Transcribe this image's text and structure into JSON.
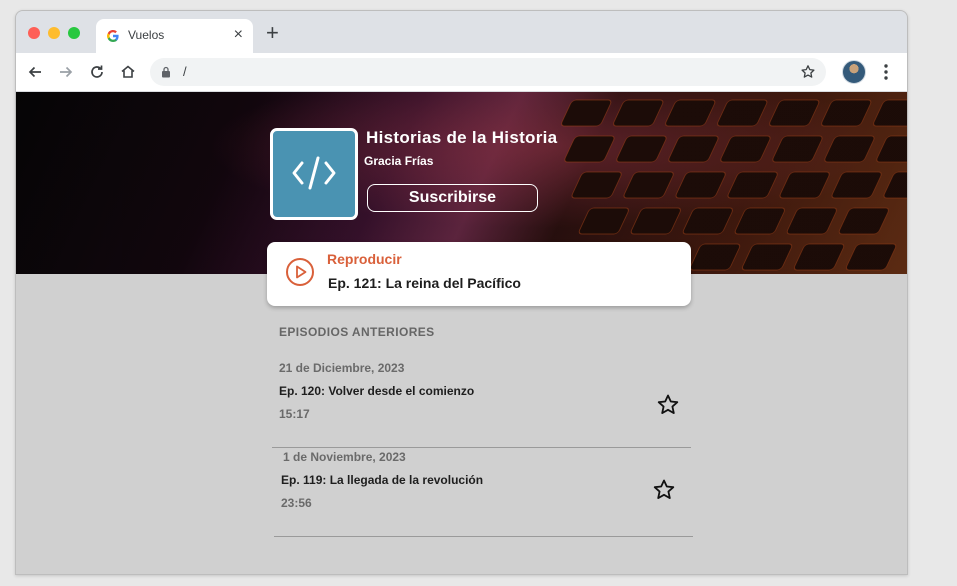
{
  "browser": {
    "tab_title": "Vuelos",
    "tab_close": "×",
    "new_tab": "+",
    "url": "/"
  },
  "podcast": {
    "title": "Historias de la Historia",
    "author": "Gracia Frías",
    "subscribe_label": "Suscribirse",
    "cover_icon": "code-icon"
  },
  "player": {
    "label": "Reproducir",
    "episode": "Ep. 121: La reina del Pacífico"
  },
  "previous": {
    "heading": "EPISODIOS ANTERIORES",
    "episodes": [
      {
        "date": "21 de Diciembre, 2023",
        "title": "Ep. 120: Volver desde el comienzo",
        "duration": "15:17"
      },
      {
        "date": "1 de Noviembre, 2023",
        "title": "Ep. 119: La llegada de la revolución",
        "duration": "23:56"
      }
    ]
  },
  "colors": {
    "accent": "#d9603a",
    "cover": "#4a93b2"
  }
}
